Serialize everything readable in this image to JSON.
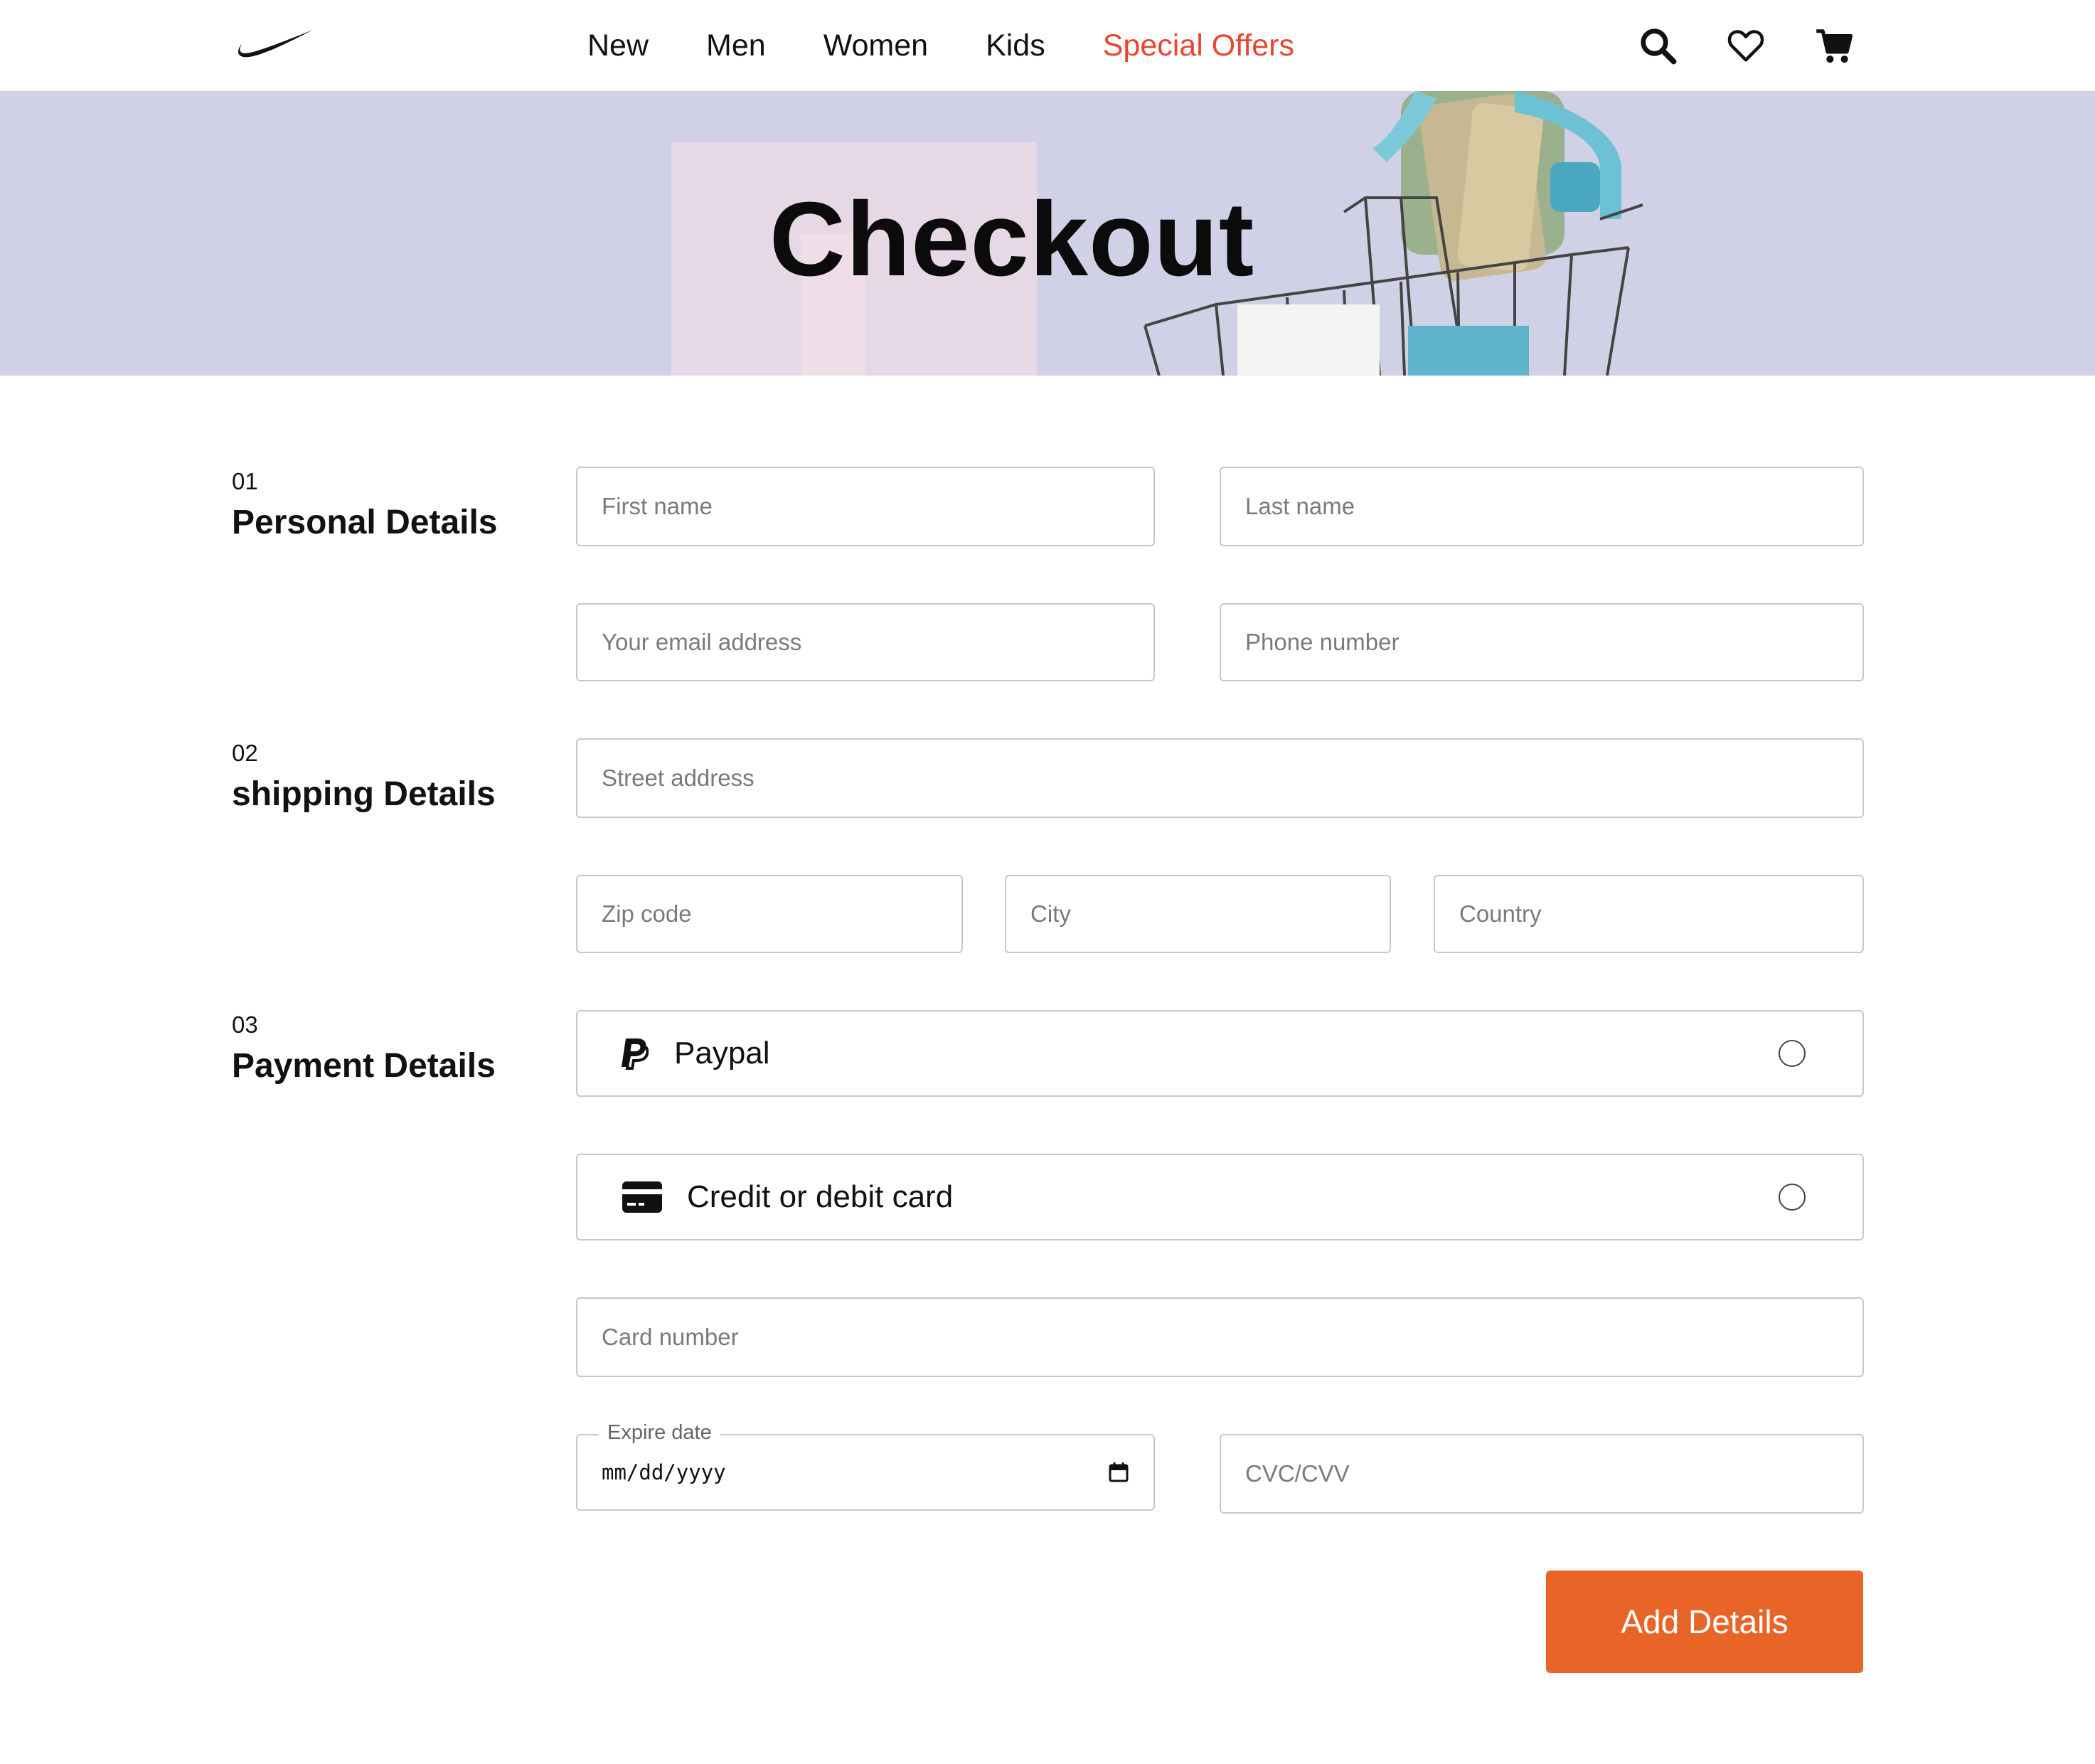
{
  "nav": {
    "links": [
      {
        "label": "New"
      },
      {
        "label": "Men"
      },
      {
        "label": "Women"
      },
      {
        "label": "Kids"
      },
      {
        "label": "Special Offers",
        "color": "#e8472f"
      }
    ],
    "icons": [
      "search-icon",
      "heart-icon",
      "cart-icon"
    ]
  },
  "hero": {
    "title": "Checkout"
  },
  "sections": {
    "personal": {
      "number": "01",
      "title": "Personal Details"
    },
    "shipping": {
      "number": "02",
      "title": "shipping Details"
    },
    "payment": {
      "number": "03",
      "title": "Payment Details"
    }
  },
  "fields": {
    "first_name": "First name",
    "last_name": "Last name",
    "email": "Your email address",
    "phone": "Phone number",
    "street": "Street address",
    "zip": "Zip code",
    "city": "City",
    "country": "Country",
    "card_number": "Card number",
    "expire_label": "Expire date",
    "expire_value": "mm/dd/yyyy",
    "cvc": "CVC/CVV"
  },
  "payment_options": [
    {
      "label": "Paypal",
      "icon": "paypal-icon",
      "selected": false
    },
    {
      "label": "Credit or debit card",
      "icon": "credit-card-icon",
      "selected": false
    }
  ],
  "submit_label": "Add Details",
  "colors": {
    "accent": "#e96527",
    "special_offers": "#e8472f",
    "hero_bg": "#d0d0e6"
  }
}
